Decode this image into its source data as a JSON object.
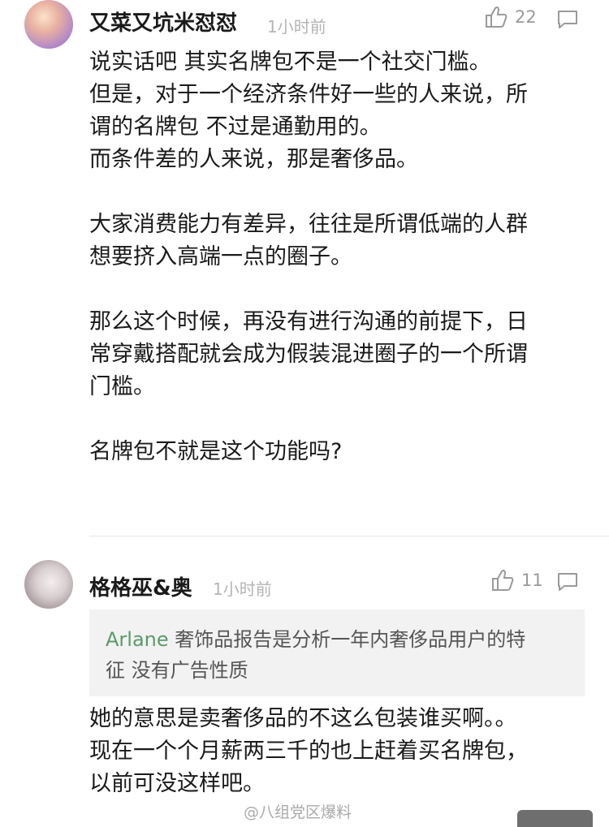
{
  "comments": [
    {
      "username": "又菜又坑米怼怼",
      "time": "1小时前",
      "likes": "22",
      "lines": [
        "说实话吧  其实名牌包不是一个社交门槛。",
        "但是，对于一个经济条件好一些的人来说，所",
        "谓的名牌包 不过是通勤用的。",
        "而条件差的人来说，那是奢侈品。",
        "",
        "大家消费能力有差异，往往是所谓低端的人群",
        "想要挤入高端一点的圈子。",
        "",
        "那么这个时候，再没有进行沟通的前提下，日",
        "常穿戴搭配就会成为假装混进圈子的一个所谓",
        "门槛。",
        "",
        "名牌包不就是这个功能吗?"
      ]
    },
    {
      "username": "格格巫&奥",
      "time": "1小时前",
      "likes": "11",
      "quote": {
        "author": "Arlane",
        "lines": [
          " 奢饰品报告是分析一年内奢侈品用户的特",
          "征 没有广告性质"
        ]
      },
      "lines": [
        "她的意思是卖奢侈品的不这么包装谁买啊。。",
        "现在一个个月薪两三千的也上赶着买名牌包，",
        "以前可没这样吧。"
      ]
    }
  ],
  "watermark": "@八组党区爆料",
  "icons": {
    "like": "thumbs-up-icon",
    "reply": "comment-bubble-icon"
  },
  "colors": {
    "quote_author": "#5a9a6a",
    "meta": "#b4b4b4"
  }
}
